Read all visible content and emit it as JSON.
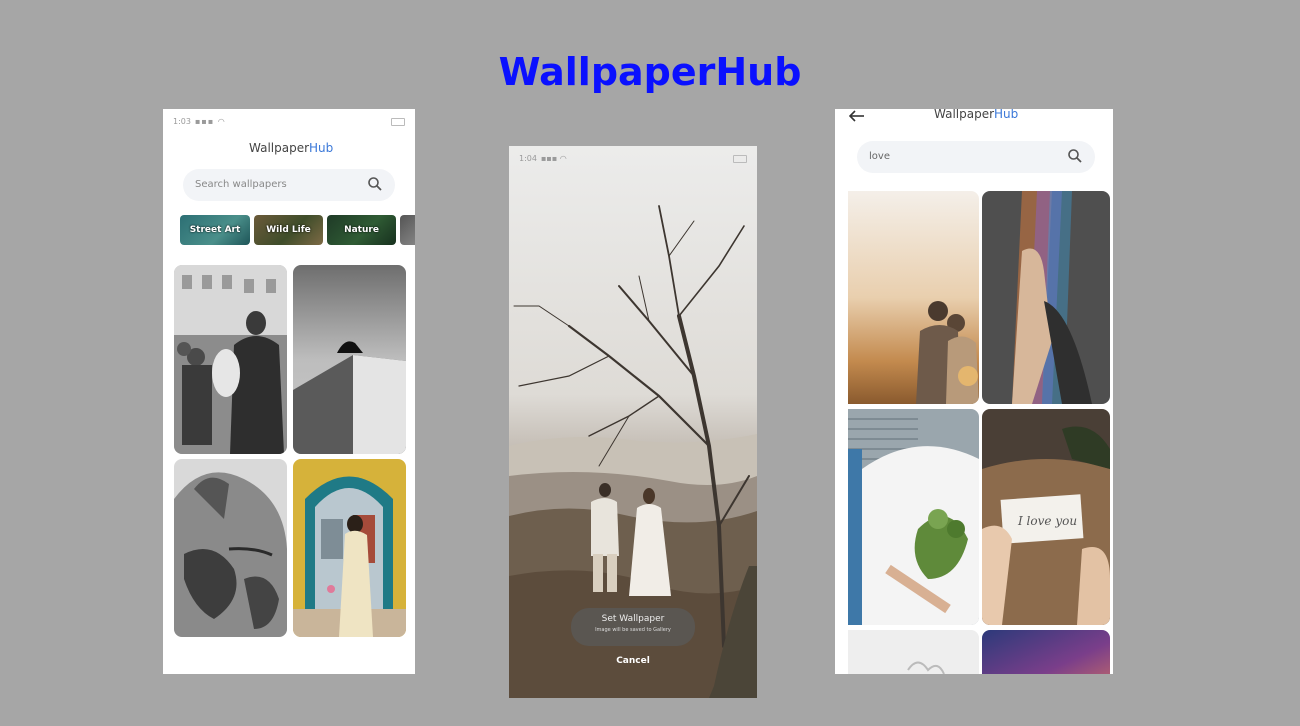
{
  "page": {
    "title": "WallpaperHub"
  },
  "screen1": {
    "status_time": "1:03",
    "app_title_part1": "Wallpaper",
    "app_title_part2": "Hub",
    "search_placeholder": "Search wallpapers",
    "categories": [
      {
        "label": "Street Art"
      },
      {
        "label": "Wild Life"
      },
      {
        "label": "Nature"
      },
      {
        "label": ""
      }
    ],
    "wallpapers": [
      "street band photo",
      "cat on wall photo",
      "tattoo back photo",
      "girl at yellow arch photo"
    ]
  },
  "screen2": {
    "status_time": "1:04",
    "set_wallpaper_label": "Set Wallpaper",
    "set_wallpaper_sub": "Image will be saved to Gallery",
    "cancel_label": "Cancel"
  },
  "screen3": {
    "app_title_part1": "Wallpaper",
    "app_title_part2": "Hub",
    "search_value": "love",
    "wallpapers": [
      "couple at sunset",
      "hands with rainbow light",
      "man holding flowers behind back",
      "hand holding i love you note",
      "white flower",
      "purple sky"
    ]
  },
  "icons": {
    "search": "search-icon",
    "back": "back-arrow-icon",
    "battery": "battery-icon"
  },
  "colors": {
    "background": "#a6a6a6",
    "title": "#0a10ff",
    "hub_accent": "#3b78d8"
  }
}
